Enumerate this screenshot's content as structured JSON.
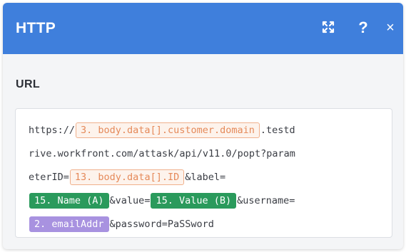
{
  "dialog": {
    "title": "HTTP",
    "icons": {
      "expand": "expand-icon",
      "help": "?",
      "close": "×"
    },
    "colors": {
      "header": "#3f7fdc",
      "pill_orange_text": "#e58a5a",
      "pill_green": "#2a9a5c",
      "pill_purple": "#a892e0"
    }
  },
  "url_field": {
    "label": "URL",
    "lines": [
      {
        "pre": "https://",
        "pill": "3. body.data[].customer.domain",
        "post": ".testd"
      },
      {
        "text": "rive.workfront.com/attask/api/v11.0/popt?param"
      },
      {
        "pre": "eterID=",
        "pill": "13. body.data[].ID",
        "post": "&label="
      },
      {
        "pill1": "15. Name (A)",
        "mid": "&value=",
        "pill2": "15. Value (B)",
        "post": "&username="
      },
      {
        "pill": "2. emailAddr",
        "post": "&password=PaSSword"
      }
    ]
  }
}
